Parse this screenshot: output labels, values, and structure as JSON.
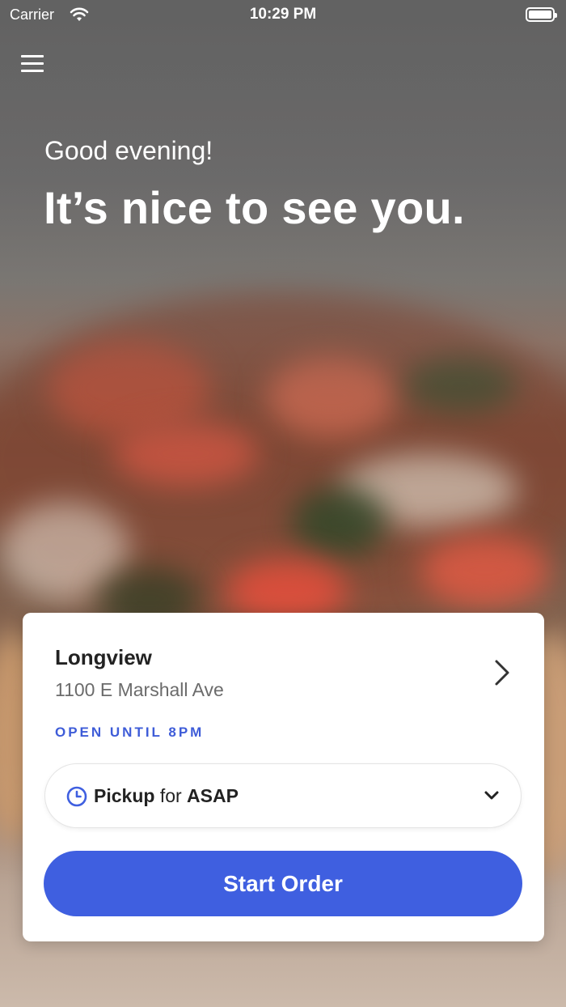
{
  "status_bar": {
    "carrier": "Carrier",
    "time": "10:29 PM"
  },
  "header": {
    "greeting": "Good evening!",
    "headline": "It’s nice to see you."
  },
  "store": {
    "name": "Longview",
    "address": "1100 E Marshall Ave",
    "hours": "OPEN UNTIL 8PM"
  },
  "order_mode": {
    "mode": "Pickup",
    "connector": "for",
    "when": "ASAP"
  },
  "actions": {
    "start_order_label": "Start Order"
  },
  "icons": {
    "menu": "hamburger-menu-icon",
    "store_chevron": "chevron-right-icon",
    "clock": "clock-icon",
    "dropdown": "chevron-down-icon",
    "wifi": "wifi-icon",
    "battery": "battery-icon"
  },
  "colors": {
    "accent": "#3f5fe0",
    "hours_text": "#3e5cd8",
    "card_bg": "#ffffff"
  }
}
